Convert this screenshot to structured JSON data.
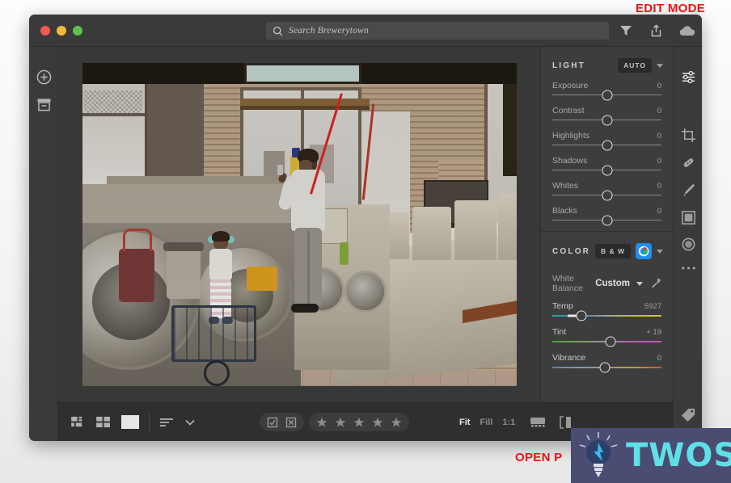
{
  "window": {
    "traffic_lights": [
      "close",
      "minimize",
      "maximize"
    ],
    "search": {
      "placeholder": "Search Brewerytown",
      "value": "Search Brewerytown",
      "icon": "search-icon"
    },
    "toolbar_icons": [
      "filter-icon",
      "share-icon",
      "cloud-icon"
    ]
  },
  "left_rail": {
    "items": [
      {
        "name": "add-photos",
        "icon": "plus-circle-icon"
      },
      {
        "name": "archive",
        "icon": "archive-box-icon"
      }
    ]
  },
  "photo": {
    "alt": "Laundromat interior with woman and child near washing machines",
    "zoom_mode": "Fit"
  },
  "edit_panel": {
    "light": {
      "title": "LIGHT",
      "auto_label": "AUTO",
      "caret": "chevron-down-icon",
      "sliders": [
        {
          "label": "Exposure",
          "value": "0",
          "pos": 50
        },
        {
          "label": "Contrast",
          "value": "0",
          "pos": 50
        },
        {
          "label": "Highlights",
          "value": "0",
          "pos": 50
        },
        {
          "label": "Shadows",
          "value": "0",
          "pos": 50
        },
        {
          "label": "Whites",
          "value": "0",
          "pos": 50
        },
        {
          "label": "Blacks",
          "value": "0",
          "pos": 50
        }
      ]
    },
    "color": {
      "title": "COLOR",
      "bw_label": "B & W",
      "color_swatch": "color-mix-icon",
      "caret": "chevron-down-icon",
      "white_balance": {
        "label": "White Balance",
        "value": "Custom",
        "eyedropper": "eyedropper-icon"
      },
      "sliders": [
        {
          "label": "Temp",
          "value": "5927",
          "pos": 27,
          "grad": "grad-temp"
        },
        {
          "label": "Tint",
          "value": "+ 19",
          "pos": 53,
          "grad": "grad-tint"
        },
        {
          "label": "Vibrance",
          "value": "0",
          "pos": 48,
          "grad": "grad-vib"
        }
      ]
    }
  },
  "tool_rail": {
    "items": [
      {
        "name": "edit-sliders",
        "icon": "sliders-icon",
        "active": true
      },
      {
        "name": "crop",
        "icon": "crop-icon",
        "active": false
      },
      {
        "name": "healing",
        "icon": "healing-brush-icon",
        "active": false
      },
      {
        "name": "brush",
        "icon": "brush-icon",
        "active": false
      },
      {
        "name": "linear-gradient",
        "icon": "gradient-icon",
        "active": false
      },
      {
        "name": "radial-gradient",
        "icon": "radial-icon",
        "active": false
      },
      {
        "name": "more-options",
        "icon": "ellipsis-icon",
        "active": false
      },
      {
        "name": "keywords-tag",
        "icon": "tag-icon",
        "active": false
      }
    ]
  },
  "bottom_bar": {
    "view_icons": [
      "grid-detail-icon",
      "grid-icon",
      "single-photo-icon"
    ],
    "sort": {
      "icon": "sort-icon",
      "caret": "chevron-down-icon"
    },
    "flags": [
      "flag-pick-icon",
      "flag-reject-icon"
    ],
    "stars": 5,
    "zoom_levels": [
      {
        "label": "Fit",
        "active": true
      },
      {
        "label": "Fill",
        "active": false
      },
      {
        "label": "1:1",
        "active": false
      }
    ],
    "right_icons": [
      "filmstrip-icon",
      "before-after-icon"
    ]
  },
  "annotations": {
    "edit_mode": "EDIT MODE",
    "open_panel": "OPEN P",
    "arrow_color": "#ee1111",
    "circle_color": "#d51111"
  },
  "watermark": {
    "text": "TWOS",
    "bg": "#4b4c72",
    "text_color": "#5fe0e8",
    "icon": "lightbulb-icon"
  }
}
